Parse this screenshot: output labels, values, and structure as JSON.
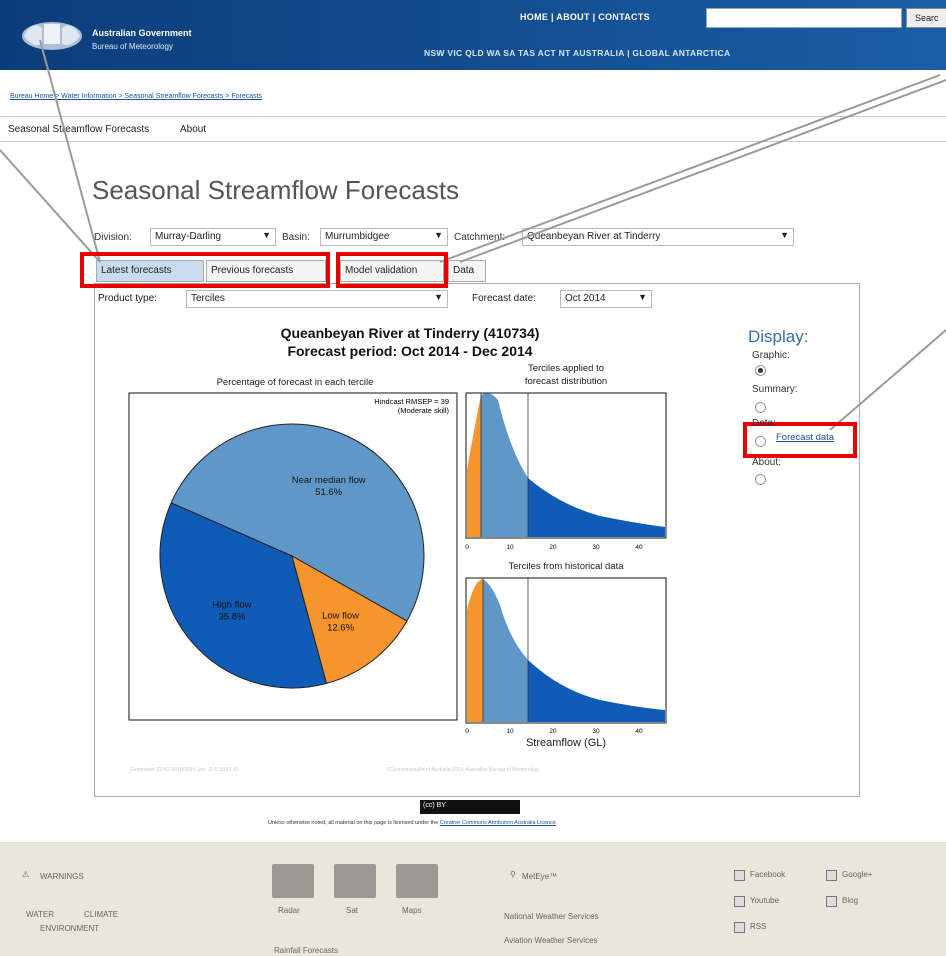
{
  "header": {
    "gov_line1": "Australian Government",
    "gov_line2": "Bureau of Meteorology",
    "top_nav": "HOME | ABOUT | CONTACTS",
    "search_button": "Searc",
    "state_nav": "NSW  VIC  QLD  WA  SA  TAS  ACT  NT  AUSTRALIA  |  GLOBAL  ANTARCTICA"
  },
  "breadcrumb": "Bureau Home > Water Information > Seasonal Streamflow Forecasts > Forecasts",
  "subnav": {
    "item1": "Seasonal Streamflow Forecasts",
    "item2": "About"
  },
  "page_title": "Seasonal Streamflow Forecasts",
  "selectors": {
    "division_label": "Division:",
    "division_value": "Murray-Darling",
    "basin_label": "Basin:",
    "basin_value": "Murrumbidgee",
    "catchment_label": "Catchment:",
    "catchment_value": "Queanbeyan River at Tinderry"
  },
  "tabs": {
    "latest": "Latest forecasts",
    "previous": "Previous forecasts",
    "validation": "Model validation",
    "data": "Data"
  },
  "product": {
    "label": "Product type:",
    "value": "Terciles",
    "date_label": "Forecast date:",
    "date_value": "Oct 2014"
  },
  "chart": {
    "title1": "Queanbeyan River at Tinderry (410734)",
    "title2": "Forecast period: Oct 2014 - Dec 2014",
    "pie_title": "Percentage of forecast in each tercile",
    "hindcast1": "Hindcast RMSEP = 39",
    "hindcast2": "(Moderate skill)",
    "dist_title1": "Terciles applied to",
    "dist_title2": "forecast distribution",
    "hist_title": "Terciles from historical data",
    "xlabel": "Streamflow (GL)",
    "x_ticks": [
      "0",
      "10",
      "20",
      "30",
      "40"
    ]
  },
  "chart_data": {
    "type": "pie",
    "title": "Percentage of forecast in each tercile",
    "slices": [
      {
        "label": "Near median flow",
        "value": 51.6,
        "display": "51.6%",
        "color": "#5f97c9"
      },
      {
        "label": "Low flow",
        "value": 12.6,
        "display": "12.6%",
        "color": "#f6942d"
      },
      {
        "label": "High flow",
        "value": 35.8,
        "display": "35.8%",
        "color": "#0f5bb5"
      }
    ]
  },
  "display": {
    "title": "Display:",
    "graphic": "Graphic:",
    "summary": "Summary:",
    "data": "Data:",
    "forecast_data": "Forecast data",
    "about": "About:"
  },
  "credits": {
    "generated": "Generated: 22:43 06/10/2014 (ver. 11.6.11/3.1.8)",
    "copyright": "©Commonwealth of Australia 2014, Australian Bureau of Meteorology"
  },
  "license": {
    "badge": "(cc) BY",
    "text": "Unless otherwise noted, all material on this page is licensed under the",
    "link": "Creative Commons Attribution Australia Licence"
  },
  "footer": {
    "warnings": "WARNINGS",
    "water": "WATER",
    "climate": "CLIMATE",
    "environment": "ENVIRONMENT",
    "radar": "Radar",
    "sat": "Sat",
    "maps": "Maps",
    "rainfall": "Rainfall Forecasts",
    "meteye": "MetEye™",
    "nws": "National Weather Services",
    "aviation": "Aviation Weather Services",
    "facebook": "Facebook",
    "googleplus": "Google+",
    "youtube": "Youtube",
    "blog": "Blog",
    "rss": "RSS"
  }
}
